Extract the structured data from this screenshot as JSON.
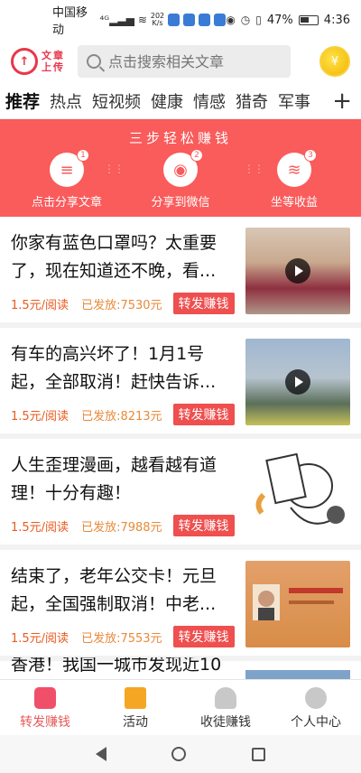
{
  "status_bar": {
    "carrier": "中国移动",
    "signal_label": "4G",
    "net_speed": "202\nK/s",
    "battery": "47%",
    "time": "4:36"
  },
  "header": {
    "logo_char": "个",
    "logo_text_line1": "文章",
    "logo_text_line2": "上传",
    "search_placeholder": "点击搜索相关文章",
    "coin_symbol": "¥"
  },
  "tabs": [
    "推荐",
    "热点",
    "短视频",
    "健康",
    "情感",
    "猎奇",
    "军事"
  ],
  "tabs_plus": "+",
  "banner": {
    "title": "三步轻松赚钱",
    "steps": [
      {
        "num": "1",
        "label": "点击分享文章",
        "glyph": "≡"
      },
      {
        "num": "2",
        "label": "分享到微信",
        "glyph": "◉"
      },
      {
        "num": "3",
        "label": "坐等收益",
        "glyph": "≋"
      }
    ]
  },
  "feed": [
    {
      "title": "你家有蓝色口罩吗？太重要了，现在知道还不晚，看...",
      "price": "1.5元/阅读",
      "issued": "已发放:7530元",
      "button": "转发赚钱",
      "video": true
    },
    {
      "title": "有车的高兴坏了！1月1号起，全部取消！赶快告诉...",
      "price": "1.5元/阅读",
      "issued": "已发放:8213元",
      "button": "转发赚钱",
      "video": true
    },
    {
      "title": "人生歪理漫画，越看越有道理！十分有趣！",
      "price": "1.5元/阅读",
      "issued": "已发放:7988元",
      "button": "转发赚钱",
      "video": false
    },
    {
      "title": "结束了，老年公交卡！元旦起，全国强制取消！中老...",
      "price": "1.5元/阅读",
      "issued": "已发放:7553元",
      "button": "转发赚钱",
      "video": false
    }
  ],
  "partial_title": "香港！我国一城市发现近10",
  "bottom_nav": [
    {
      "label": "转发赚钱",
      "active": true
    },
    {
      "label": "活动",
      "active": false
    },
    {
      "label": "收徒赚钱",
      "active": false
    },
    {
      "label": "个人中心",
      "active": false
    }
  ],
  "colors": {
    "accent": "#fa5b5b",
    "price": "#e85a1e",
    "button": "#ef4f4f"
  }
}
